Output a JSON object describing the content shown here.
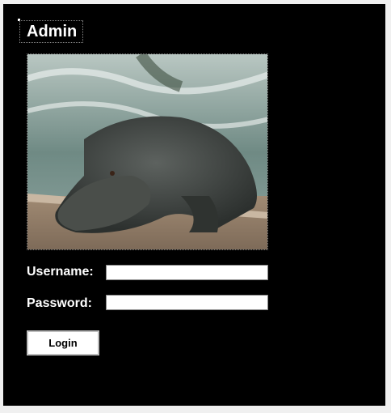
{
  "header": {
    "title": "Admin"
  },
  "image": {
    "subject": "alligator-photo"
  },
  "form": {
    "username_label": "Username:",
    "username_value": "",
    "password_label": "Password:",
    "password_value": "",
    "login_label": "Login"
  }
}
